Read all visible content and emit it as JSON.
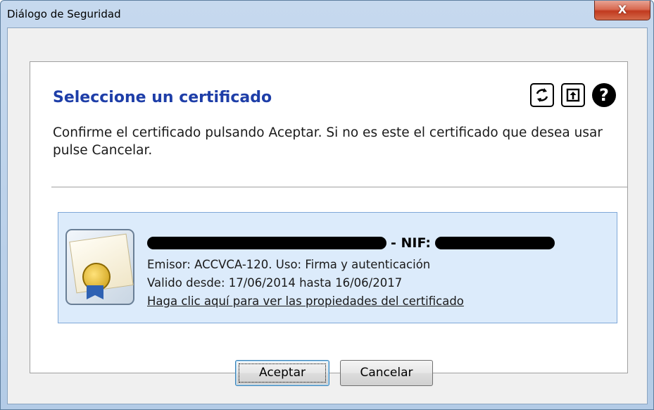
{
  "window": {
    "title": "Diálogo de Seguridad",
    "close_glyph": "X"
  },
  "panel": {
    "heading": "Seleccione un certificado",
    "instructions": "Confirme el certificado pulsando Aceptar. Si no es este el certificado que desea usar pulse Cancelar.",
    "icons": [
      "refresh-icon",
      "export-icon",
      "help-icon"
    ],
    "help_glyph": "?"
  },
  "certificate": {
    "nif_label": "- NIF:",
    "issuer": "Emisor: ACCVCA-120. Uso: Firma y autenticación",
    "validity": "Valido desde: 17/06/2014 hasta 16/06/2017",
    "link": "Haga clic aquí para ver las propiedades del certificado"
  },
  "buttons": {
    "accept": "Aceptar",
    "cancel": "Cancelar"
  },
  "colors": {
    "heading": "#1e3ea8",
    "card_background": "#dcebfb",
    "card_border": "#7fa8d8",
    "close_button": "#c1391f"
  }
}
